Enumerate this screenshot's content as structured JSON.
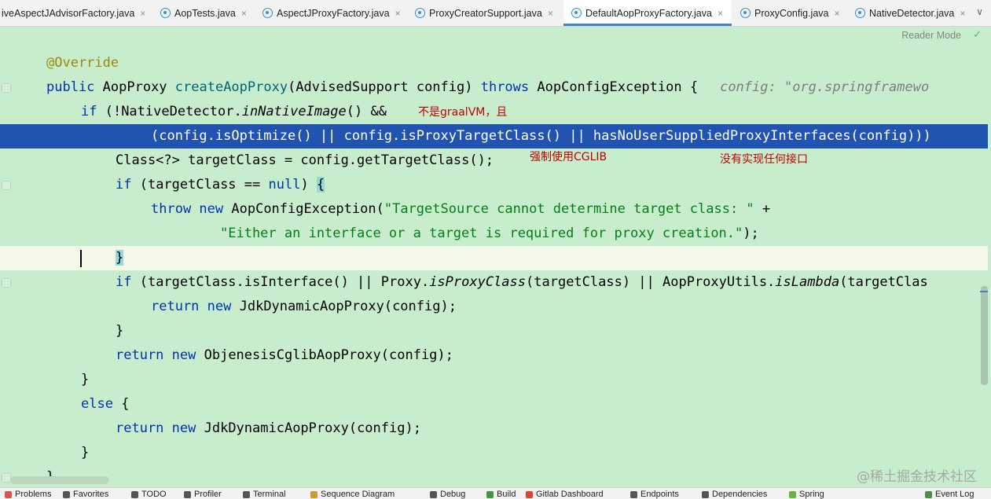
{
  "tabs": [
    {
      "label": "iveAspectJAdvisorFactory.java",
      "icon": "class-icon",
      "active": false
    },
    {
      "label": "AopTests.java",
      "icon": "class-icon",
      "active": false
    },
    {
      "label": "AspectJProxyFactory.java",
      "icon": "class-icon",
      "active": false
    },
    {
      "label": "ProxyCreatorSupport.java",
      "icon": "class-icon",
      "active": false
    },
    {
      "label": "DefaultAopProxyFactory.java",
      "icon": "class-icon",
      "active": true
    },
    {
      "label": "ProxyConfig.java",
      "icon": "class-icon",
      "active": false
    },
    {
      "label": "NativeDetector.java",
      "icon": "class-icon",
      "active": false
    }
  ],
  "tab_close_glyph": "×",
  "tab_overflow": "∨",
  "reader_mode": "Reader Mode",
  "code": {
    "l1": "@Override",
    "l2_kw": "public",
    "l2_type": " AopProxy ",
    "l2_fn": "createAopProxy",
    "l2_rest": "(AdvisedSupport config) ",
    "l2_kw2": "throws",
    "l2_rest2": " AopConfigException {",
    "l2_hint": "config: \"org.springframewo",
    "l3_kw": "if",
    "l3_a": " (!NativeDetector.",
    "l3_fn": "inNativeImage",
    "l3_b": "() &&",
    "l4": "(config.isOptimize() || config.isProxyTargetClass() || hasNoUserSuppliedProxyInterfaces(config)))",
    "l5": "Class<?> targetClass = config.getTargetClass();",
    "l6_kw": "if",
    "l6_a": " (targetClass == ",
    "l6_kw2": "null",
    "l6_b": ") ",
    "l6_brace": "{",
    "l7_kw": "throw",
    "l7_kw2": " new",
    "l7_a": " AopConfigException(",
    "l7_str": "\"TargetSource cannot determine target class: \"",
    "l7_b": " +",
    "l8_str": "\"Either an interface or a target is required for proxy creation.\"",
    "l8_b": ");",
    "l9_brace": "}",
    "l10_kw": "if",
    "l10_a": " (targetClass.isInterface() || Proxy.",
    "l10_fn": "isProxyClass",
    "l10_b": "(targetClass) || AopProxyUtils.",
    "l10_fn2": "isLambda",
    "l10_c": "(targetClas",
    "l11_kw": "return",
    "l11_kw2": " new",
    "l11_a": " JdkDynamicAopProxy(config);",
    "l12": "}",
    "l13_kw": "return",
    "l13_kw2": " new",
    "l13_a": " ObjenesisCglibAopProxy(config);",
    "l14": "}",
    "l15_kw": "else",
    "l15_a": " {",
    "l16_kw": "return",
    "l16_kw2": " new",
    "l16_a": " JdkDynamicAopProxy(config);",
    "l17": "}",
    "l18": "}"
  },
  "notes": {
    "not_graalvm": "不是graalVM，且",
    "force_cglib": "强制使用CGLIB",
    "no_interfaces": "没有实现任何接口"
  },
  "watermark": "@稀土掘金技术社区",
  "toolwindows": [
    {
      "label": "Problems",
      "icon": "problems-icon",
      "color": "#d9534f"
    },
    {
      "label": "Favorites",
      "icon": "star-icon",
      "color": "#555555"
    },
    {
      "label": "TODO",
      "icon": "todo-icon",
      "color": "#555555"
    },
    {
      "label": "Profiler",
      "icon": "profiler-icon",
      "color": "#555555"
    },
    {
      "label": "Terminal",
      "icon": "terminal-icon",
      "color": "#555555"
    },
    {
      "label": "Sequence Diagram",
      "icon": "sequence-icon",
      "color": "#c89b2b"
    },
    {
      "label": "Debug",
      "icon": "debug-icon",
      "color": "#555555"
    },
    {
      "label": "Build",
      "icon": "build-icon",
      "color": "#4a8f4a"
    },
    {
      "label": "Gitlab Dashboard",
      "icon": "gitlab-icon",
      "color": "#e24329"
    },
    {
      "label": "Endpoints",
      "icon": "endpoints-icon",
      "color": "#555555"
    },
    {
      "label": "Dependencies",
      "icon": "dependencies-icon",
      "color": "#555555"
    },
    {
      "label": "Spring",
      "icon": "spring-icon",
      "color": "#6db33f"
    },
    {
      "label": "Event Log",
      "icon": "event-log-icon",
      "color": "#4a8f4a"
    }
  ]
}
